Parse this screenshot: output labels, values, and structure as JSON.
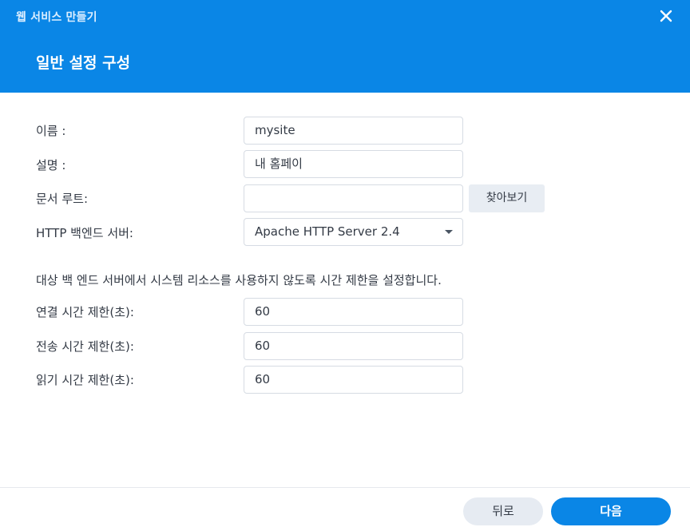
{
  "window": {
    "title": "웹 서비스 만들기",
    "close_icon": "close-icon"
  },
  "step": {
    "title": "일반 설정 구성"
  },
  "form": {
    "name": {
      "label": "이름 :",
      "value": "mysite"
    },
    "description": {
      "label": "설명 :",
      "value": "내 홈페이"
    },
    "doc_root": {
      "label": "문서 루트:",
      "value": "",
      "browse_label": "찾아보기"
    },
    "backend": {
      "label": "HTTP 백엔드 서버:",
      "selected": "Apache HTTP Server 2.4"
    }
  },
  "timeout_info": "대상 백 엔드 서버에서 시스템 리소스를 사용하지 않도록 시간 제한을 설정합니다.",
  "timeouts": {
    "connect": {
      "label": "연결 시간 제한(초):",
      "value": "60"
    },
    "send": {
      "label": "전송 시간 제한(초):",
      "value": "60"
    },
    "read": {
      "label": "읽기 시간 제한(초):",
      "value": "60"
    }
  },
  "footer": {
    "back_label": "뒤로",
    "next_label": "다음"
  },
  "colors": {
    "accent": "#0a86e6",
    "header_bg": "#0a86e6",
    "button_secondary_bg": "#e6ebf2"
  }
}
